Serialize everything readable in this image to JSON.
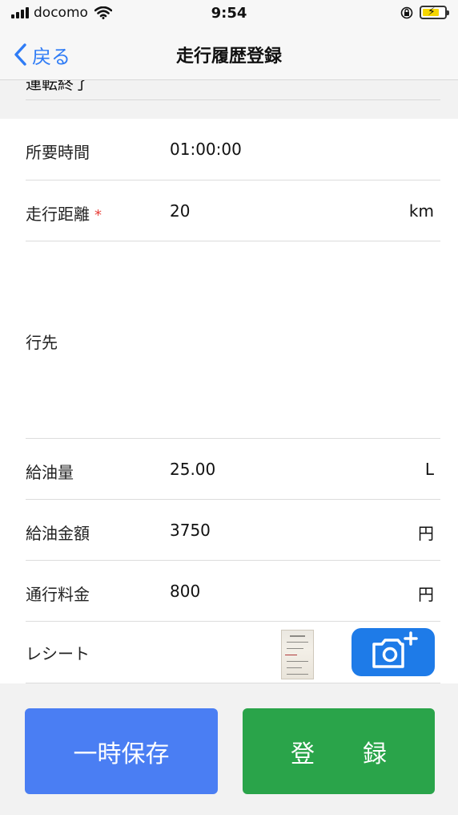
{
  "status_bar": {
    "carrier": "docomo",
    "time": "9:54"
  },
  "nav": {
    "back_label": "戻る",
    "title": "走行履歴登録"
  },
  "prev_section_label": "運転終了",
  "rows": [
    {
      "label": "所要時間",
      "value": "01:00:00",
      "unit": ""
    },
    {
      "label": "走行距離",
      "required_mark": "*",
      "value": "20",
      "unit": "km"
    },
    {
      "label": "行先",
      "value": "",
      "unit": ""
    },
    {
      "label": "給油量",
      "value": "25.00",
      "unit": "L"
    },
    {
      "label": "給油金額",
      "value": "3750",
      "unit": "円"
    },
    {
      "label": "通行料金",
      "value": "800",
      "unit": "円"
    },
    {
      "label": "レシート"
    }
  ],
  "buttons": {
    "temp_save": "一時保存",
    "register_chars": [
      "登",
      "録"
    ]
  },
  "colors": {
    "accent_blue": "#2f7cf6",
    "temp_save_bg": "#4a7ef3",
    "register_bg": "#2aa44a",
    "camera_bg": "#1e7be8",
    "required": "#e8403a"
  },
  "icons": [
    "back-chevron-icon",
    "signal-icon",
    "wifi-icon",
    "lock-rotation-icon",
    "battery-charging-icon",
    "camera-add-icon"
  ]
}
